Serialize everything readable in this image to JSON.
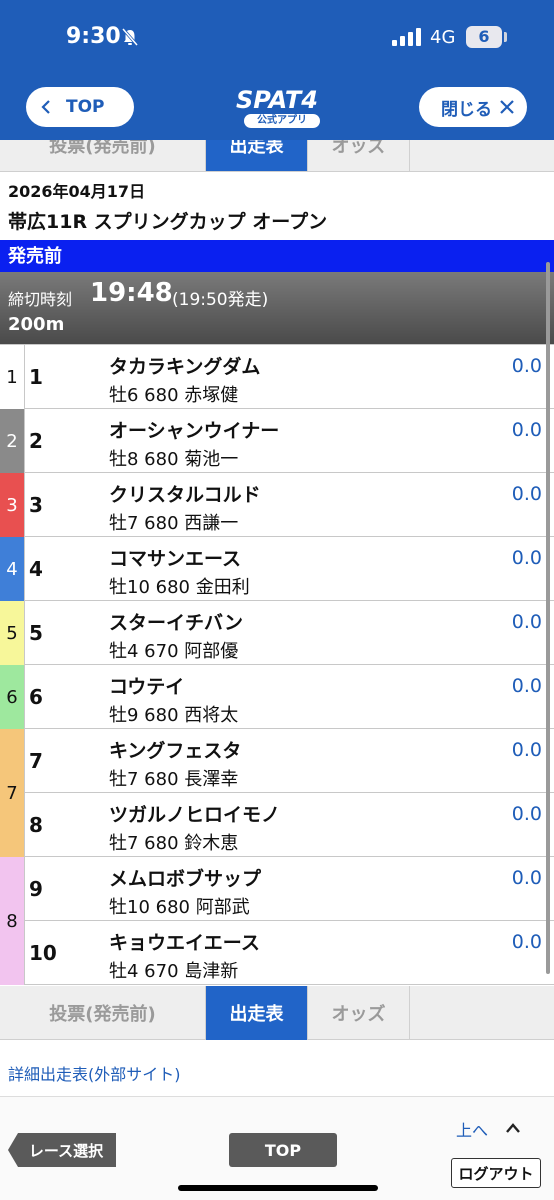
{
  "status_bar": {
    "time": "9:30",
    "network": "4G",
    "battery": "6"
  },
  "header": {
    "top_button": "TOP",
    "close_button": "閉じる",
    "logo": "SPAT4",
    "logo_tag": "公式アプリ"
  },
  "tabs": [
    "投票(発売前)",
    "出走表",
    "オッズ"
  ],
  "race": {
    "date": "2026年04月17日",
    "name": "帯広11R スプリングカップ オープン",
    "status": "発売前",
    "deadline_label": "締切時刻",
    "deadline_time": "19:48",
    "start_time": "(19:50発走)",
    "distance": "200m"
  },
  "frames": [
    {
      "num": "1",
      "bg": "#ffffff",
      "color": "#111111"
    },
    {
      "num": "2",
      "bg": "#8a8a8a",
      "color": "#ffffff"
    },
    {
      "num": "3",
      "bg": "#e85050",
      "color": "#ffffff"
    },
    {
      "num": "4",
      "bg": "#3f7fd8",
      "color": "#ffffff"
    },
    {
      "num": "5",
      "bg": "#f7f79a",
      "color": "#111111"
    },
    {
      "num": "6",
      "bg": "#9ee89e",
      "color": "#111111"
    },
    {
      "num": "7",
      "bg": "#f5c67a",
      "color": "#111111"
    },
    {
      "num": "8",
      "bg": "#f2c4ef",
      "color": "#111111"
    }
  ],
  "horses": [
    {
      "num": "1",
      "name": "タカラキングダム",
      "info": "牡6 680  赤塚健",
      "odds": "0.0"
    },
    {
      "num": "2",
      "name": "オーシャンウイナー",
      "info": "牡8 680  菊池一",
      "odds": "0.0"
    },
    {
      "num": "3",
      "name": "クリスタルコルド",
      "info": "牡7 680  西謙一",
      "odds": "0.0"
    },
    {
      "num": "4",
      "name": "コマサンエース",
      "info": "牡10 680  金田利",
      "odds": "0.0"
    },
    {
      "num": "5",
      "name": "スターイチバン",
      "info": "牡4 670  阿部優",
      "odds": "0.0"
    },
    {
      "num": "6",
      "name": "コウテイ",
      "info": "牡9 680  西将太",
      "odds": "0.0"
    },
    {
      "num": "7",
      "name": "キングフェスタ",
      "info": "牡7 680  長澤幸",
      "odds": "0.0"
    },
    {
      "num": "8",
      "name": "ツガルノヒロイモノ",
      "info": "牡7 680  鈴木恵",
      "odds": "0.0"
    },
    {
      "num": "9",
      "name": "メムロボブサップ",
      "info": "牡10 680  阿部武",
      "odds": "0.0"
    },
    {
      "num": "10",
      "name": "キョウエイエース",
      "info": "牡4 670  島津新",
      "odds": "0.0"
    }
  ],
  "external_link": "詳細出走表(外部サイト)",
  "footer": {
    "race_select": "レース選択",
    "top": "TOP",
    "page_up": "上へ",
    "logout": "ログアウト"
  }
}
